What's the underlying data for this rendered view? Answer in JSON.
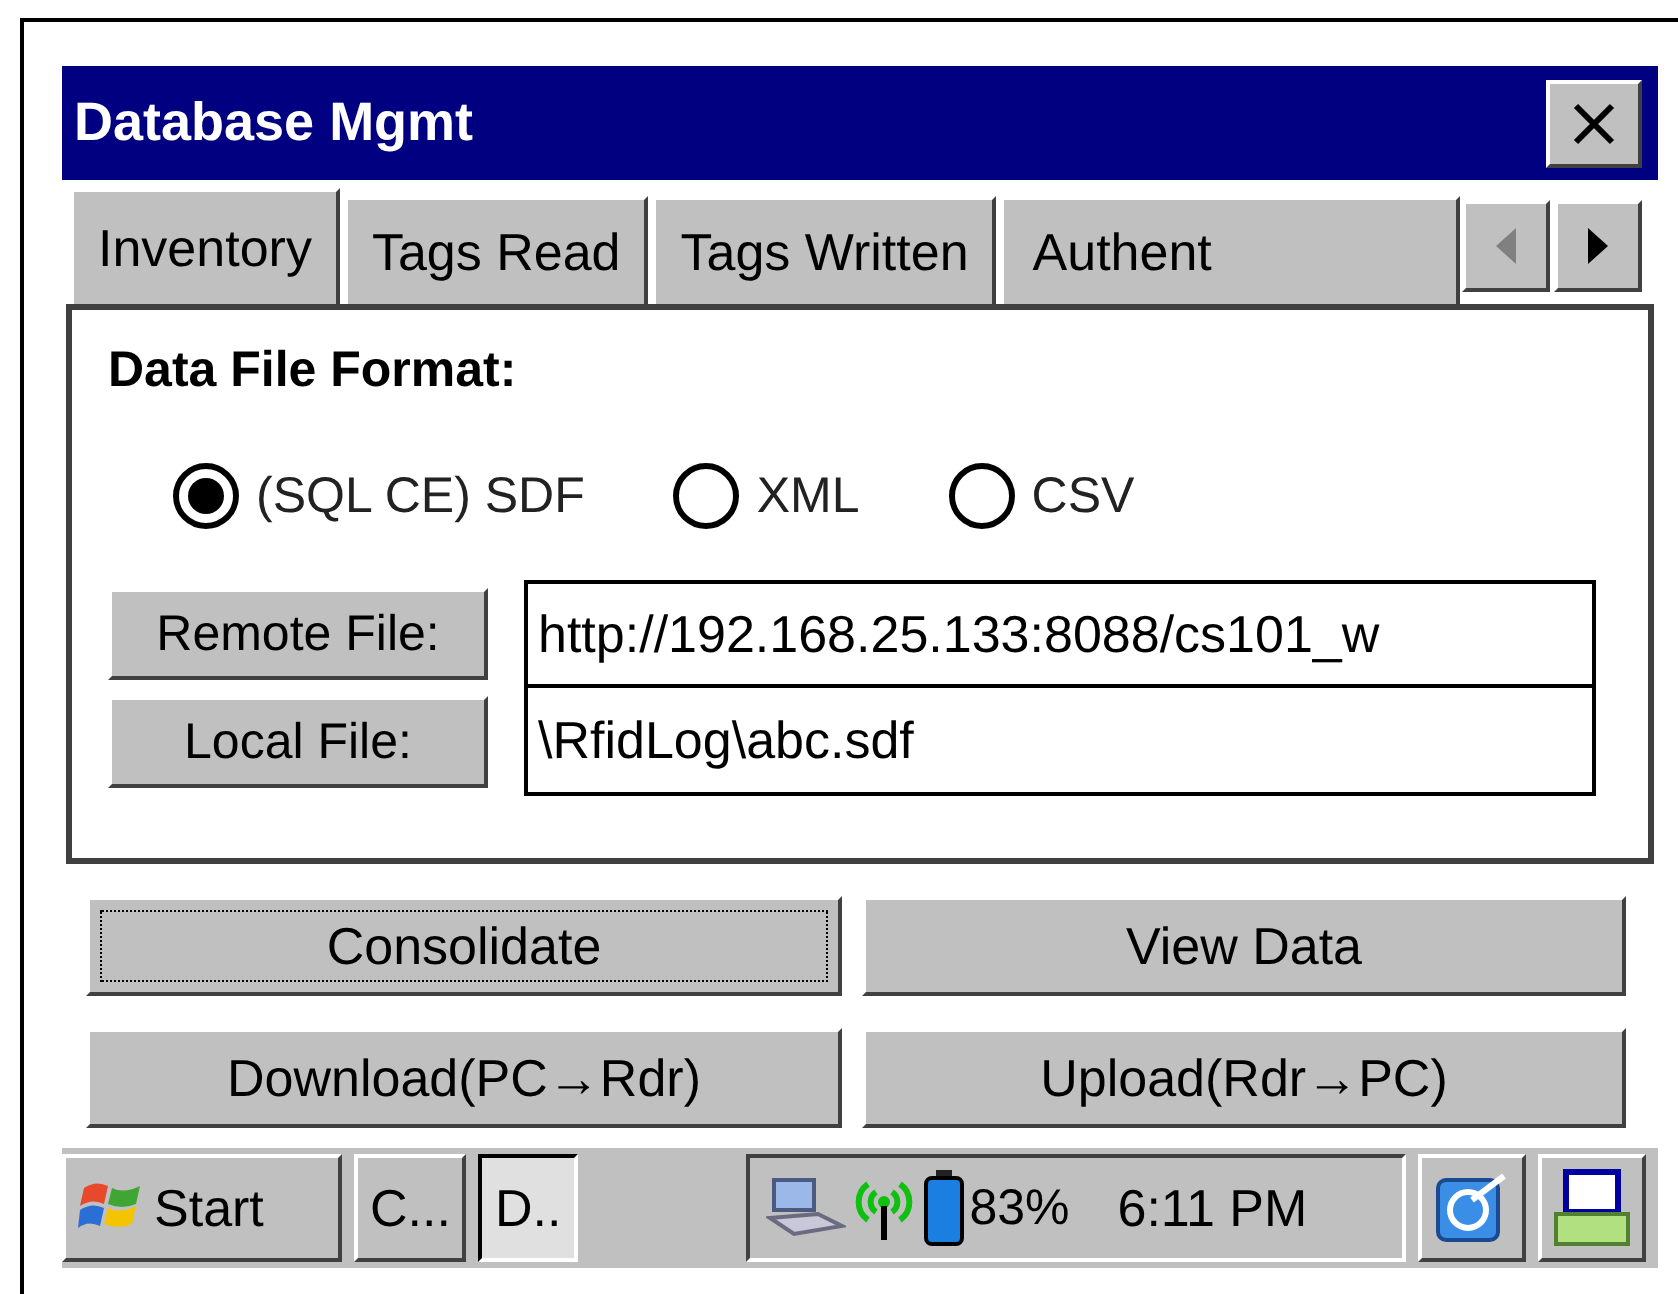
{
  "window": {
    "title": "Database Mgmt"
  },
  "tabs": [
    {
      "label": "Inventory",
      "selected": true
    },
    {
      "label": "Tags Read",
      "selected": false
    },
    {
      "label": "Tags Written",
      "selected": false
    },
    {
      "label": "Authent",
      "selected": false
    }
  ],
  "tab_scroll": {
    "back_disabled": true,
    "forward_disabled": false
  },
  "format": {
    "label": "Data File Format:",
    "options": [
      {
        "label": "(SQL CE) SDF",
        "selected": true
      },
      {
        "label": "XML",
        "selected": false
      },
      {
        "label": "CSV",
        "selected": false
      }
    ]
  },
  "files": [
    {
      "button": "Remote File:",
      "value": "http://192.168.25.133:8088/cs101_w"
    },
    {
      "button": "Local File:",
      "value": "\\RfidLog\\abc.sdf"
    }
  ],
  "actions": [
    {
      "label": "Consolidate",
      "focused": true
    },
    {
      "label": "View Data",
      "focused": false
    },
    {
      "label": "Download(PC→Rdr)",
      "focused": false
    },
    {
      "label": "Upload(Rdr→PC)",
      "focused": false
    }
  ],
  "taskbar": {
    "start": "Start",
    "tasks": [
      {
        "label": "C...",
        "selected": false
      },
      {
        "label": "D..",
        "selected": true
      }
    ],
    "battery": "83%",
    "time": "6:11 PM"
  }
}
